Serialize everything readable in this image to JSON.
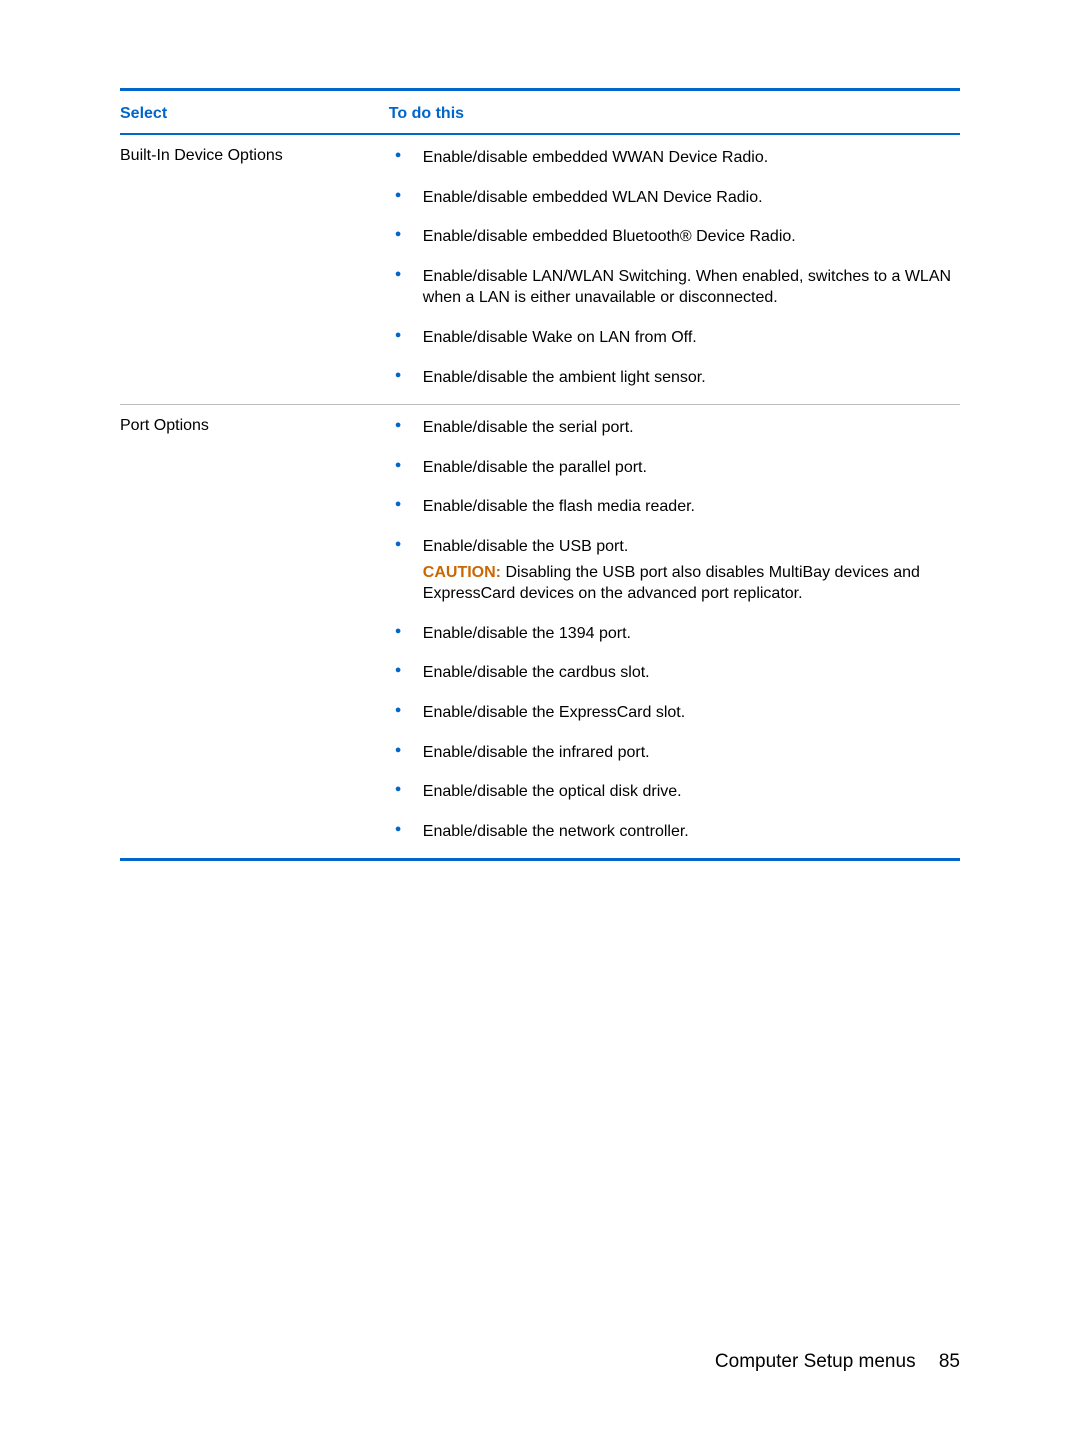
{
  "table": {
    "headers": {
      "select": "Select",
      "action": "To do this"
    },
    "rows": [
      {
        "label": "Built-In Device Options",
        "items": [
          {
            "text": "Enable/disable embedded WWAN Device Radio."
          },
          {
            "text": "Enable/disable embedded WLAN Device Radio."
          },
          {
            "text": "Enable/disable embedded Bluetooth® Device Radio."
          },
          {
            "text": "Enable/disable LAN/WLAN Switching. When enabled, switches to a WLAN when a LAN is either unavailable or disconnected."
          },
          {
            "text": "Enable/disable Wake on LAN from Off."
          },
          {
            "text": "Enable/disable the ambient light sensor."
          }
        ]
      },
      {
        "label": "Port Options",
        "group1": [
          {
            "text": "Enable/disable the serial port."
          },
          {
            "text": "Enable/disable the parallel port."
          },
          {
            "text": "Enable/disable the flash media reader."
          },
          {
            "text": "Enable/disable the USB port."
          }
        ],
        "caution": {
          "label": "CAUTION:",
          "text": "Disabling the USB port also disables MultiBay devices and ExpressCard devices on the advanced port replicator."
        },
        "group2": [
          {
            "text": "Enable/disable the 1394 port."
          },
          {
            "text": "Enable/disable the cardbus slot."
          },
          {
            "text": "Enable/disable the ExpressCard slot."
          },
          {
            "text": "Enable/disable the infrared port."
          },
          {
            "text": "Enable/disable the optical disk drive."
          },
          {
            "text": "Enable/disable the network controller."
          }
        ]
      }
    ]
  },
  "footer": {
    "title": "Computer Setup menus",
    "page": "85"
  }
}
